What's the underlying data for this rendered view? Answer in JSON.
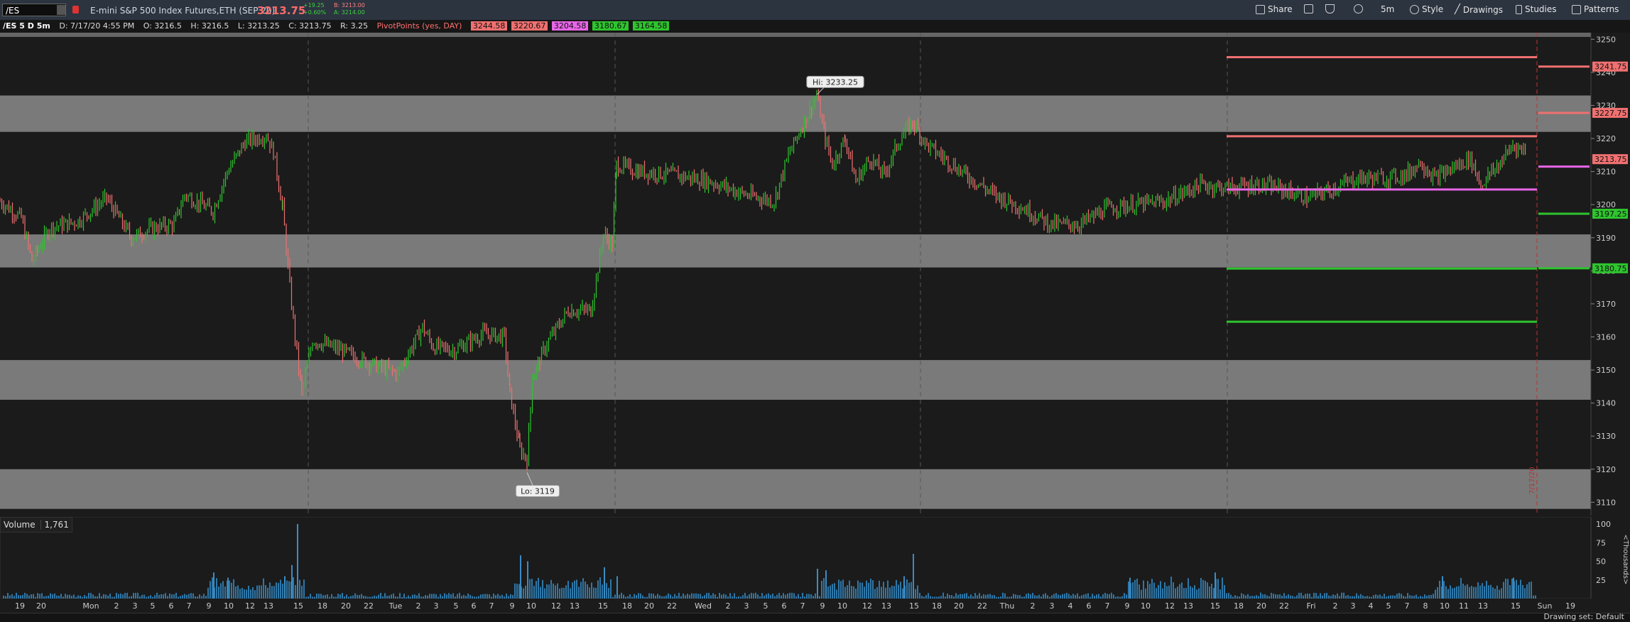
{
  "toolbar": {
    "symbol": "/ES",
    "instrument": "E-mini S&P 500 Index Futures,ETH (SEP 20)",
    "last_price": "3213.75",
    "change": "+19.25",
    "change_pct": "+0.60%",
    "bid": "B: 3213.00",
    "ask": "A: 3214.00",
    "buttons": [
      "Share",
      "5m",
      "Style",
      "Drawings",
      "Studies",
      "Patterns"
    ]
  },
  "infobar": {
    "chart_label": "/ES 5 D 5m",
    "date": "D: 7/17/20 4:55 PM",
    "open": "O: 3216.5",
    "high": "H: 3216.5",
    "low": "L: 3213.25",
    "close": "C: 3213.75",
    "range": "R: 3.25",
    "study": "PivotPoints (yes, DAY)",
    "pivots": [
      {
        "label": "3244.58",
        "color": "#f07070"
      },
      {
        "label": "3220.67",
        "color": "#f07070"
      },
      {
        "label": "3204.58",
        "color": "#e866e8"
      },
      {
        "label": "3180.67",
        "color": "#2ec42e"
      },
      {
        "label": "3164.58",
        "color": "#2ec42e"
      }
    ]
  },
  "colors": {
    "up": "#2ec42e",
    "down": "#f07070",
    "pivot": "#e866e8",
    "zone": "#7a7a7a",
    "background": "#1b1b1b"
  },
  "chart_data": {
    "type": "candlestick",
    "yaxis_ticks": [
      "3250",
      "3240",
      "3230",
      "3220",
      "3210",
      "3200",
      "3190",
      "3180",
      "3170",
      "3160",
      "3150",
      "3140",
      "3130",
      "3120",
      "3110"
    ],
    "ylim": [
      3106,
      3252
    ],
    "shaded_zones": [
      [
        3222,
        3233
      ],
      [
        3181,
        3191
      ],
      [
        3141,
        3153
      ],
      [
        3108,
        3120
      ]
    ],
    "annotations": [
      {
        "text": "Hi: 3233.25",
        "value": 3233.25
      },
      {
        "text": "Lo: 3119",
        "value": 3119
      }
    ],
    "price_labels": [
      {
        "text": "3241.75",
        "value": 3241.75,
        "color": "#f07070"
      },
      {
        "text": "3227.75",
        "value": 3227.75,
        "color": "#f07070"
      },
      {
        "text": "3213.75",
        "value": 3213.75,
        "color": "#f07070"
      },
      {
        "text": "3197.25",
        "value": 3197.25,
        "color": "#2ec42e"
      },
      {
        "text": "3180.75",
        "value": 3180.75,
        "color": "#2ec42e"
      }
    ],
    "pivot_lines_fri": [
      {
        "value": 3244.58,
        "color": "#f07070"
      },
      {
        "value": 3220.67,
        "color": "#f07070"
      },
      {
        "value": 3204.58,
        "color": "#e866e8"
      },
      {
        "value": 3180.67,
        "color": "#2ec42e"
      },
      {
        "value": 3164.58,
        "color": "#2ec42e"
      }
    ],
    "pivot_lines_next": [
      {
        "value": 3241.75,
        "color": "#f07070"
      },
      {
        "value": 3227.75,
        "color": "#f07070"
      },
      {
        "value": 3211.5,
        "color": "#e866e8"
      },
      {
        "value": 3197.25,
        "color": "#2ec42e"
      },
      {
        "value": 3180.75,
        "color": "#2ec42e"
      }
    ],
    "price_path": [
      [
        0,
        3201
      ],
      [
        30,
        3196
      ],
      [
        45,
        3183
      ],
      [
        70,
        3193
      ],
      [
        110,
        3195
      ],
      [
        150,
        3202
      ],
      [
        185,
        3190
      ],
      [
        215,
        3193
      ],
      [
        245,
        3194
      ],
      [
        260,
        3203
      ],
      [
        300,
        3198
      ],
      [
        320,
        3210
      ],
      [
        345,
        3219
      ],
      [
        375,
        3221
      ],
      [
        385,
        3216
      ],
      [
        398,
        3199
      ],
      [
        408,
        3175
      ],
      [
        418,
        3155
      ],
      [
        425,
        3143
      ],
      [
        440,
        3159
      ],
      [
        480,
        3156
      ],
      [
        520,
        3152
      ],
      [
        560,
        3149
      ],
      [
        595,
        3163
      ],
      [
        610,
        3157
      ],
      [
        640,
        3156
      ],
      [
        680,
        3161
      ],
      [
        710,
        3160
      ],
      [
        718,
        3143
      ],
      [
        732,
        3126
      ],
      [
        742,
        3123
      ],
      [
        750,
        3148
      ],
      [
        770,
        3158
      ],
      [
        800,
        3168
      ],
      [
        832,
        3168
      ],
      [
        850,
        3191
      ],
      [
        862,
        3188
      ],
      [
        868,
        3212
      ],
      [
        900,
        3210
      ],
      [
        950,
        3209
      ],
      [
        1000,
        3207
      ],
      [
        1050,
        3203
      ],
      [
        1090,
        3201
      ],
      [
        1110,
        3215
      ],
      [
        1130,
        3224
      ],
      [
        1150,
        3233
      ],
      [
        1162,
        3220
      ],
      [
        1172,
        3212
      ],
      [
        1190,
        3220
      ],
      [
        1205,
        3207
      ],
      [
        1225,
        3214
      ],
      [
        1245,
        3209
      ],
      [
        1265,
        3219
      ],
      [
        1285,
        3225
      ],
      [
        1305,
        3218
      ],
      [
        1330,
        3214
      ],
      [
        1360,
        3209
      ],
      [
        1400,
        3203
      ],
      [
        1440,
        3199
      ],
      [
        1480,
        3194
      ],
      [
        1520,
        3194
      ],
      [
        1560,
        3199
      ],
      [
        1600,
        3200
      ],
      [
        1640,
        3201
      ],
      [
        1690,
        3206
      ],
      [
        1730,
        3205
      ],
      [
        1770,
        3206
      ],
      [
        1800,
        3205
      ],
      [
        1840,
        3202
      ],
      [
        1880,
        3205
      ],
      [
        1910,
        3208
      ],
      [
        1950,
        3208
      ],
      [
        1980,
        3209
      ],
      [
        2000,
        3213
      ],
      [
        2020,
        3208
      ],
      [
        2045,
        3211
      ],
      [
        2070,
        3214
      ],
      [
        2085,
        3206
      ],
      [
        2110,
        3212
      ],
      [
        2130,
        3218
      ],
      [
        2150,
        3216
      ]
    ],
    "volume_axis": [
      "100",
      "75",
      "50",
      "25"
    ],
    "volume_unit": "Thousands",
    "volume_value": "1,761",
    "volume_spikes": [
      {
        "x": 418,
        "v": 100
      },
      {
        "x": 410,
        "v": 45
      },
      {
        "x": 400,
        "v": 30
      },
      {
        "x": 300,
        "v": 35
      },
      {
        "x": 320,
        "v": 28
      },
      {
        "x": 732,
        "v": 58
      },
      {
        "x": 742,
        "v": 50
      },
      {
        "x": 850,
        "v": 42
      },
      {
        "x": 868,
        "v": 30
      },
      {
        "x": 1150,
        "v": 40
      },
      {
        "x": 1162,
        "v": 38
      },
      {
        "x": 1285,
        "v": 60
      },
      {
        "x": 1272,
        "v": 30
      },
      {
        "x": 1590,
        "v": 28
      },
      {
        "x": 1710,
        "v": 35
      },
      {
        "x": 2030,
        "v": 30
      },
      {
        "x": 2130,
        "v": 28
      }
    ],
    "x_ticks": [
      {
        "label": "19",
        "x": 28
      },
      {
        "label": "20",
        "x": 58
      },
      {
        "label": "Mon",
        "x": 128
      },
      {
        "label": "2",
        "x": 164
      },
      {
        "label": "3",
        "x": 190
      },
      {
        "label": "5",
        "x": 215
      },
      {
        "label": "6",
        "x": 241
      },
      {
        "label": "7",
        "x": 266
      },
      {
        "label": "9",
        "x": 294
      },
      {
        "label": "10",
        "x": 322
      },
      {
        "label": "12",
        "x": 352
      },
      {
        "label": "13",
        "x": 378
      },
      {
        "label": "15",
        "x": 420
      },
      {
        "label": "18",
        "x": 454
      },
      {
        "label": "20",
        "x": 487
      },
      {
        "label": "22",
        "x": 519
      },
      {
        "label": "Tue",
        "x": 557
      },
      {
        "label": "2",
        "x": 589
      },
      {
        "label": "3",
        "x": 614
      },
      {
        "label": "5",
        "x": 642
      },
      {
        "label": "6",
        "x": 667
      },
      {
        "label": "7",
        "x": 692
      },
      {
        "label": "9",
        "x": 721
      },
      {
        "label": "10",
        "x": 748
      },
      {
        "label": "12",
        "x": 783
      },
      {
        "label": "13",
        "x": 809
      },
      {
        "label": "15",
        "x": 849
      },
      {
        "label": "18",
        "x": 883
      },
      {
        "label": "20",
        "x": 914
      },
      {
        "label": "22",
        "x": 946
      },
      {
        "label": "Wed",
        "x": 990
      },
      {
        "label": "2",
        "x": 1025
      },
      {
        "label": "3",
        "x": 1051
      },
      {
        "label": "5",
        "x": 1078
      },
      {
        "label": "6",
        "x": 1104
      },
      {
        "label": "7",
        "x": 1130
      },
      {
        "label": "9",
        "x": 1158
      },
      {
        "label": "10",
        "x": 1186
      },
      {
        "label": "12",
        "x": 1221
      },
      {
        "label": "13",
        "x": 1248
      },
      {
        "label": "15",
        "x": 1287
      },
      {
        "label": "18",
        "x": 1319
      },
      {
        "label": "20",
        "x": 1350
      },
      {
        "label": "22",
        "x": 1383
      },
      {
        "label": "Thu",
        "x": 1418
      },
      {
        "label": "2",
        "x": 1454
      },
      {
        "label": "3",
        "x": 1481
      },
      {
        "label": "4",
        "x": 1507
      },
      {
        "label": "6",
        "x": 1533
      },
      {
        "label": "7",
        "x": 1559
      },
      {
        "label": "9",
        "x": 1587
      },
      {
        "label": "10",
        "x": 1613
      },
      {
        "label": "12",
        "x": 1647
      },
      {
        "label": "13",
        "x": 1673
      },
      {
        "label": "15",
        "x": 1711
      },
      {
        "label": "18",
        "x": 1744
      },
      {
        "label": "20",
        "x": 1776
      },
      {
        "label": "22",
        "x": 1808
      },
      {
        "label": "Fri",
        "x": 1846
      },
      {
        "label": "2",
        "x": 1880
      },
      {
        "label": "3",
        "x": 1905
      },
      {
        "label": "4",
        "x": 1930
      },
      {
        "label": "5",
        "x": 1955
      },
      {
        "label": "7",
        "x": 1981
      },
      {
        "label": "8",
        "x": 2007
      },
      {
        "label": "10",
        "x": 2034
      },
      {
        "label": "11",
        "x": 2061
      },
      {
        "label": "13",
        "x": 2088
      },
      {
        "label": "15",
        "x": 2134
      },
      {
        "label": "Sun",
        "x": 2175
      },
      {
        "label": "19",
        "x": 2211
      }
    ],
    "day_separators": [
      434,
      866,
      1296,
      1728
    ],
    "now_label": "7/17/20"
  },
  "status": {
    "drawing_set": "Drawing set: Default"
  }
}
